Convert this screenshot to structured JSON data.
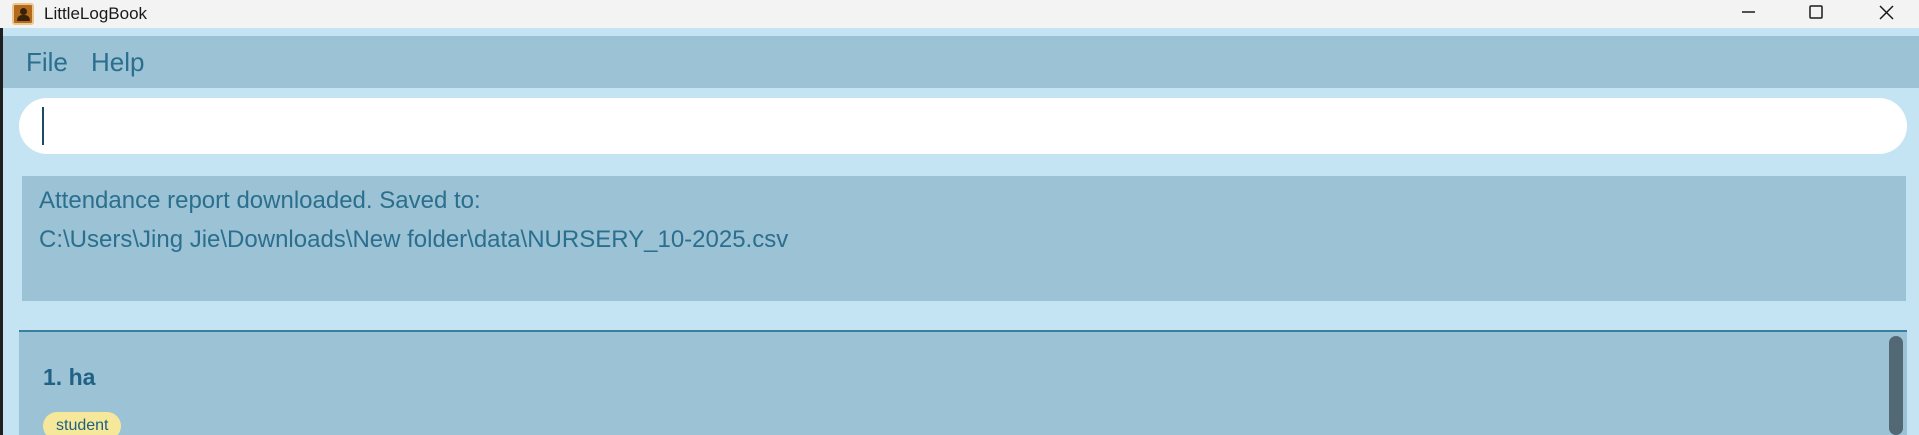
{
  "window": {
    "title": "LittleLogBook",
    "icon": "person-book-icon"
  },
  "menu": {
    "items": [
      {
        "label": "File"
      },
      {
        "label": "Help"
      }
    ]
  },
  "command_box": {
    "value": "",
    "placeholder": ""
  },
  "result": {
    "lines": [
      "Attendance report downloaded. Saved to:",
      "C:\\Users\\Jing Jie\\Downloads\\New folder\\data\\NURSERY_10-2025.csv"
    ]
  },
  "persons": [
    {
      "index_name": "1. ha",
      "tags": [
        "student"
      ]
    }
  ],
  "colors": {
    "background": "#c4e4f4",
    "panel": "#9cc2d6",
    "text": "#2a6f8e",
    "tag": "#f6e89a",
    "scroll_thumb": "#526874"
  }
}
